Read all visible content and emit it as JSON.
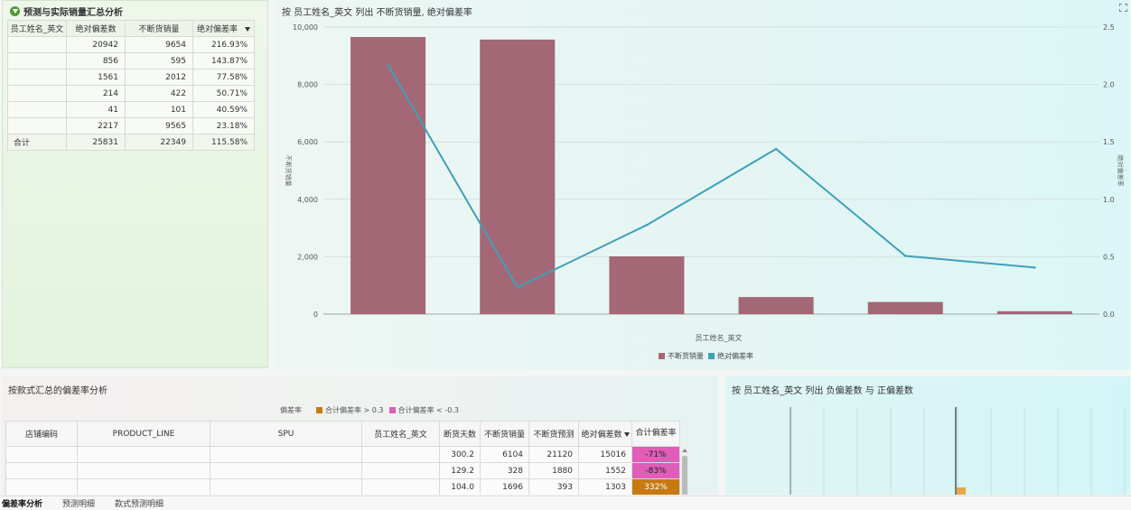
{
  "summary_panel": {
    "title": "预测与实际销量汇总分析",
    "columns": [
      "员工姓名_英文",
      "绝对偏差数",
      "不断货销量",
      "绝对偏差率"
    ],
    "rows": [
      {
        "name": "",
        "abs_dev": "20942",
        "sales": "9654",
        "rate": "216.93%"
      },
      {
        "name": "",
        "abs_dev": "856",
        "sales": "595",
        "rate": "143.87%"
      },
      {
        "name": "",
        "abs_dev": "1561",
        "sales": "2012",
        "rate": "77.58%"
      },
      {
        "name": "",
        "abs_dev": "214",
        "sales": "422",
        "rate": "50.71%"
      },
      {
        "name": "",
        "abs_dev": "41",
        "sales": "101",
        "rate": "40.59%"
      },
      {
        "name": "",
        "abs_dev": "2217",
        "sales": "9565",
        "rate": "23.18%"
      }
    ],
    "total": {
      "name": "合计",
      "abs_dev": "25831",
      "sales": "22349",
      "rate": "115.58%"
    }
  },
  "chart_data": {
    "type": "bar",
    "title": "按 员工姓名_英文 列出 不断货销量, 绝对偏差率",
    "xlabel": "员工姓名_英文",
    "ylabel": "不断货销量",
    "y2label": "绝对偏差率",
    "categories": [
      "",
      "",
      "",
      "",
      "",
      ""
    ],
    "ylim": [
      0,
      10000
    ],
    "y2lim": [
      0,
      2.5
    ],
    "yticks": [
      "0",
      "2,000",
      "4,000",
      "6,000",
      "8,000",
      "10,000"
    ],
    "y2ticks": [
      "0.0",
      "0.5",
      "1.0",
      "1.5",
      "2.0",
      "2.5"
    ],
    "series": [
      {
        "name": "不断货销量",
        "type": "bar",
        "axis": "left",
        "color": "#a46775",
        "values": [
          9654,
          9565,
          2012,
          595,
          422,
          101
        ]
      },
      {
        "name": "绝对偏差率",
        "type": "line",
        "axis": "right",
        "color": "#3ea0b9",
        "values": [
          2.1693,
          0.2318,
          0.7758,
          1.4387,
          0.5071,
          0.4059
        ]
      }
    ],
    "legend": "bottom-center",
    "grid": true
  },
  "deviation_panel": {
    "title": "按款式汇总的偏差率分析",
    "legend_title": "偏差率",
    "legend_items": [
      {
        "label": "合计偏差率 > 0.3",
        "color": "#c77a12"
      },
      {
        "label": "合计偏差率 < -0.3",
        "color": "#e05db8"
      }
    ],
    "columns": [
      "店铺编码",
      "PRODUCT_LINE",
      "SPU",
      "员工姓名_英文",
      "断货天数",
      "不断货销量",
      "不断货预测",
      "绝对偏差数",
      "合计偏差率"
    ],
    "rows": [
      {
        "store": "",
        "line": "",
        "spu": "",
        "name": "",
        "days": "300.2",
        "sales": "6104",
        "forecast": "21120",
        "abs_dev": "15016",
        "rate": "-71%",
        "kind": "neg"
      },
      {
        "store": "",
        "line": "",
        "spu": "",
        "name": "",
        "days": "129.2",
        "sales": "328",
        "forecast": "1880",
        "abs_dev": "1552",
        "rate": "-83%",
        "kind": "neg"
      },
      {
        "store": "",
        "line": "",
        "spu": "",
        "name": "",
        "days": "104.0",
        "sales": "1696",
        "forecast": "393",
        "abs_dev": "1303",
        "rate": "332%",
        "kind": "pos"
      }
    ]
  },
  "posneg_panel": {
    "title": "按 员工姓名_英文 列出 负偏差数 与 正偏差数",
    "bar_color": "#e3a94a"
  },
  "tabs": [
    {
      "label": "偏差率分析",
      "active": true
    },
    {
      "label": "预测明细",
      "active": false
    },
    {
      "label": "款式预测明细",
      "active": false
    }
  ]
}
